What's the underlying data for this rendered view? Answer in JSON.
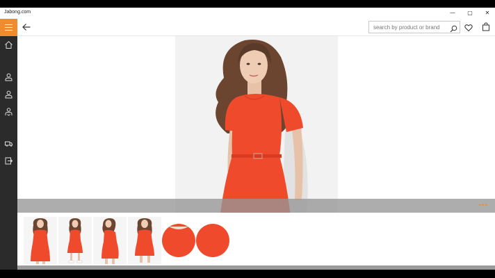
{
  "window": {
    "title": "Jabong.com",
    "controls": {
      "minimize": "—",
      "maximize": "▢",
      "close": "✕"
    }
  },
  "header": {
    "search": {
      "placeholder": "search by product or brand",
      "value": ""
    },
    "icons": [
      "back-arrow-icon",
      "search-icon",
      "heart-icon",
      "shopping-bag-icon"
    ]
  },
  "sidebar": {
    "items": [
      "menu-icon",
      "home-icon",
      "user-icon",
      "account-icon",
      "wishlist-user-icon",
      "delivery-truck-icon",
      "logout-icon"
    ]
  },
  "gallery": {
    "more_indicator": "•••",
    "thumbnails": [
      "thumbnail-1",
      "thumbnail-2",
      "thumbnail-3",
      "thumbnail-4",
      "thumbnail-5-fabric-detail",
      "thumbnail-6-fabric-detail"
    ]
  },
  "colors": {
    "accent": "#f08c2d",
    "sidebar": "#2b2b2b",
    "dress": "#f04a2d",
    "band": "#969696"
  }
}
